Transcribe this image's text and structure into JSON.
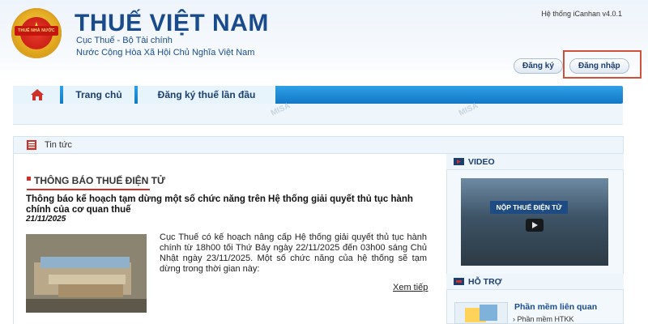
{
  "header": {
    "emblem_text": "THUẾ NHÀ NƯỚC",
    "title": "THUẾ VIỆT NAM",
    "subtitle_1": "Cục Thuế - Bộ Tài chính",
    "subtitle_2": "Nước Cộng Hòa Xã Hội Chủ Nghĩa Việt Nam",
    "version": "Hệ thống iCanhan v4.0.1",
    "register_label": "Đăng ký",
    "login_label": "Đăng nhập"
  },
  "nav": {
    "home_icon": "home-icon",
    "tabs": [
      "Trang chủ",
      "Đăng ký thuế lần đầu"
    ]
  },
  "news": {
    "panel_title": "Tin tức",
    "section_title": "THÔNG BÁO THUẾ ĐIỆN TỬ",
    "article": {
      "title": "Thông báo kế hoạch tạm dừng một số chức năng trên Hệ thống giải quyết thủ tục hành chính của cơ quan thuế",
      "date": "21/11/2025",
      "summary": "Cục Thuế có kế hoạch nâng cấp Hệ thống giải quyết thủ tục hành chính từ 18h00 tối Thứ Bảy ngày 22/11/2025 đến 03h00 sáng Chủ Nhật ngày 23/11/2025. Một số chức năng của hệ thống sẽ tạm dừng trong thời gian này:",
      "read_more": "Xem tiếp"
    }
  },
  "sidebar": {
    "video_title": "VIDEO",
    "video_banner": "NỘP THUẾ ĐIỆN TỬ",
    "support_title": "HỖ TRỢ",
    "support_link": "Phần mềm liên quan",
    "support_item": "Phần mềm HTKK"
  },
  "colors": {
    "brand_blue": "#1a4b8c",
    "nav_blue": "#1f8bd6",
    "accent_red": "#d0302a"
  }
}
